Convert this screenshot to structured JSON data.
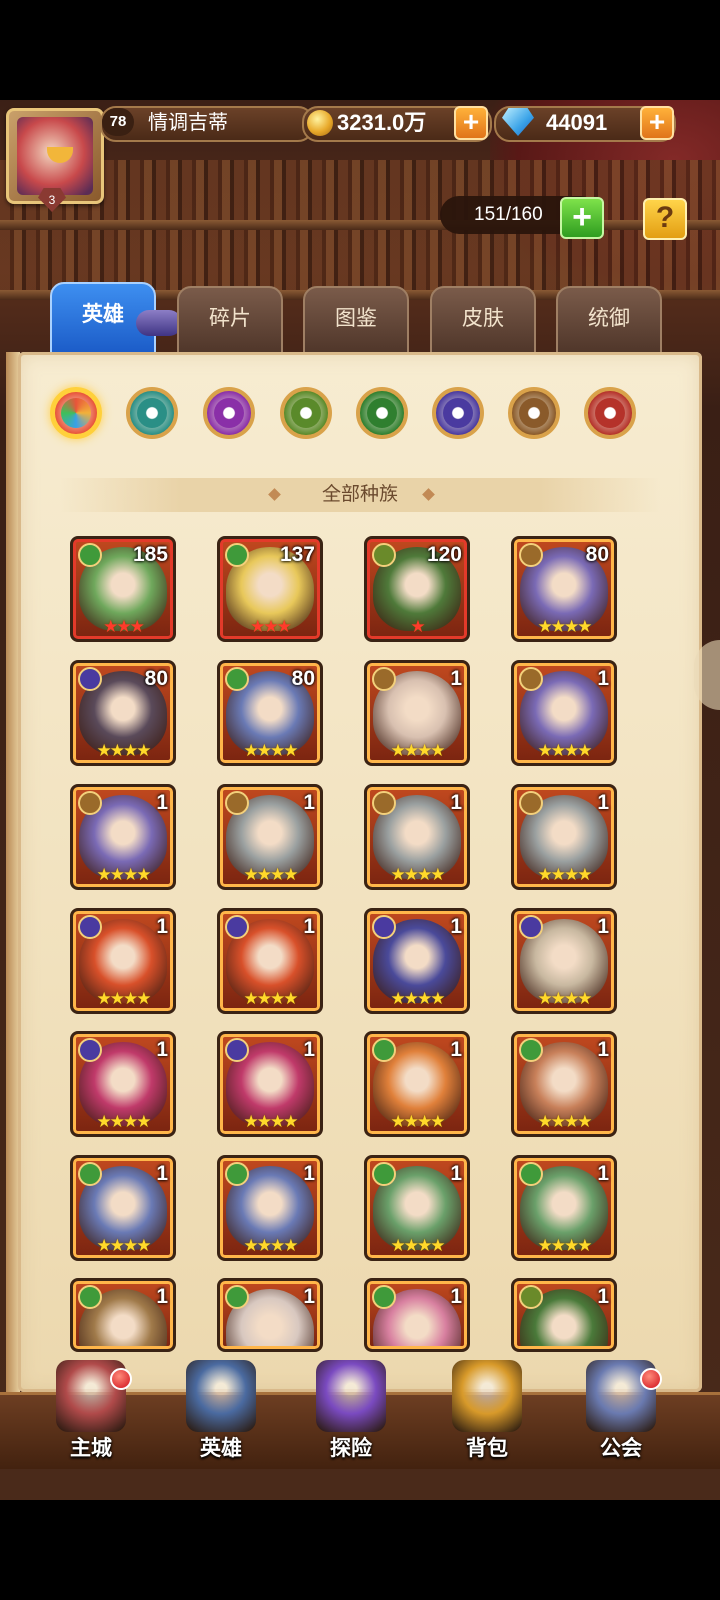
{
  "player": {
    "level": "78",
    "name": "情调吉蒂",
    "avatar_rank": "3"
  },
  "currency": {
    "gold": "3231.0万",
    "gems": "44091"
  },
  "capacity": "151/160",
  "tabs": [
    {
      "label": "英雄",
      "active": true
    },
    {
      "label": "碎片",
      "active": false
    },
    {
      "label": "图鉴",
      "active": false
    },
    {
      "label": "皮肤",
      "active": false
    },
    {
      "label": "统御",
      "active": false
    }
  ],
  "race_filters": [
    {
      "icon": "all-races-icon",
      "color": "#e8543a",
      "selected": true
    },
    {
      "icon": "forest-race-icon",
      "color": "#2a8f86"
    },
    {
      "icon": "shadow-race-icon",
      "color": "#8a2fa8"
    },
    {
      "icon": "horde-race-icon",
      "color": "#5a8a2a"
    },
    {
      "icon": "nature-race-icon",
      "color": "#2f7f2f"
    },
    {
      "icon": "undead-race-icon",
      "color": "#4a3aa0"
    },
    {
      "icon": "fortress-race-icon",
      "color": "#8a5a2a"
    },
    {
      "icon": "abyss-race-icon",
      "color": "#b5322a"
    }
  ],
  "race_label": "全部种族",
  "heroes": [
    {
      "level": "185",
      "race": "#3f9a3a",
      "stars": "★★★",
      "red": true,
      "art": "#6fa85c"
    },
    {
      "level": "137",
      "race": "#3f9a3a",
      "stars": "★★★",
      "red": true,
      "art": "#e8c85a"
    },
    {
      "level": "120",
      "race": "#6a8a2a",
      "stars": "★",
      "red": true,
      "art": "#4f7a3a"
    },
    {
      "level": "80",
      "race": "#9a6a2a",
      "stars": "★★★★",
      "red": false,
      "art": "#7a6ab5"
    },
    {
      "level": "80",
      "race": "#4a3aa0",
      "stars": "★★★★",
      "red": false,
      "art": "#5a4a5a"
    },
    {
      "level": "80",
      "race": "#3f9a3a",
      "stars": "★★★★",
      "red": false,
      "art": "#6a7ab5"
    },
    {
      "level": "1",
      "race": "#9a6a2a",
      "stars": "★★★★",
      "red": false,
      "art": "#d8c0b0"
    },
    {
      "level": "1",
      "race": "#9a6a2a",
      "stars": "★★★★",
      "red": false,
      "art": "#7a6ab5"
    },
    {
      "level": "1",
      "race": "#9a6a2a",
      "stars": "★★★★",
      "red": false,
      "art": "#7a6ab5"
    },
    {
      "level": "1",
      "race": "#9a6a2a",
      "stars": "★★★★",
      "red": false,
      "art": "#9aa0a0"
    },
    {
      "level": "1",
      "race": "#9a6a2a",
      "stars": "★★★★",
      "red": false,
      "art": "#9aa0a0"
    },
    {
      "level": "1",
      "race": "#9a6a2a",
      "stars": "★★★★",
      "red": false,
      "art": "#9aa0a0"
    },
    {
      "level": "1",
      "race": "#4a3aa0",
      "stars": "★★★★",
      "red": false,
      "art": "#d8502a"
    },
    {
      "level": "1",
      "race": "#4a3aa0",
      "stars": "★★★★",
      "red": false,
      "art": "#d8502a"
    },
    {
      "level": "1",
      "race": "#4a3aa0",
      "stars": "★★★★",
      "red": false,
      "art": "#4a4a9a"
    },
    {
      "level": "1",
      "race": "#4a3aa0",
      "stars": "★★★★",
      "red": false,
      "art": "#c8b8a0"
    },
    {
      "level": "1",
      "race": "#4a3aa0",
      "stars": "★★★★",
      "red": false,
      "art": "#c03a6a"
    },
    {
      "level": "1",
      "race": "#4a3aa0",
      "stars": "★★★★",
      "red": false,
      "art": "#c03a6a"
    },
    {
      "level": "1",
      "race": "#3f9a3a",
      "stars": "★★★★",
      "red": false,
      "art": "#e0803a"
    },
    {
      "level": "1",
      "race": "#3f9a3a",
      "stars": "★★★★",
      "red": false,
      "art": "#c8805a"
    },
    {
      "level": "1",
      "race": "#3f9a3a",
      "stars": "★★★★",
      "red": false,
      "art": "#6a7ab5"
    },
    {
      "level": "1",
      "race": "#3f9a3a",
      "stars": "★★★★",
      "red": false,
      "art": "#6a7ab5"
    },
    {
      "level": "1",
      "race": "#3f9a3a",
      "stars": "★★★★",
      "red": false,
      "art": "#6aa06a"
    },
    {
      "level": "1",
      "race": "#3f9a3a",
      "stars": "★★★★",
      "red": false,
      "art": "#6aa06a"
    },
    {
      "level": "1",
      "race": "#3f9a3a",
      "stars": "",
      "red": false,
      "art": "#a07a4a"
    },
    {
      "level": "1",
      "race": "#3f9a3a",
      "stars": "",
      "red": false,
      "art": "#d8c8c0"
    },
    {
      "level": "1",
      "race": "#3f9a3a",
      "stars": "",
      "red": false,
      "art": "#d880a0"
    },
    {
      "level": "1",
      "race": "#6a8a2a",
      "stars": "",
      "red": false,
      "art": "#4a7a3a"
    }
  ],
  "nav": [
    {
      "label": "主城",
      "icon": "castle-icon",
      "color": "#b04a4a",
      "badge": true
    },
    {
      "label": "英雄",
      "icon": "hero-portrait-icon",
      "color": "#4a6aa0",
      "badge": false
    },
    {
      "label": "探险",
      "icon": "portal-icon",
      "color": "#7a4ac0",
      "badge": false
    },
    {
      "label": "背包",
      "icon": "backpack-icon",
      "color": "#d89a2a",
      "badge": false
    },
    {
      "label": "公会",
      "icon": "guild-tower-icon",
      "color": "#6a7ab0",
      "badge": true
    }
  ]
}
